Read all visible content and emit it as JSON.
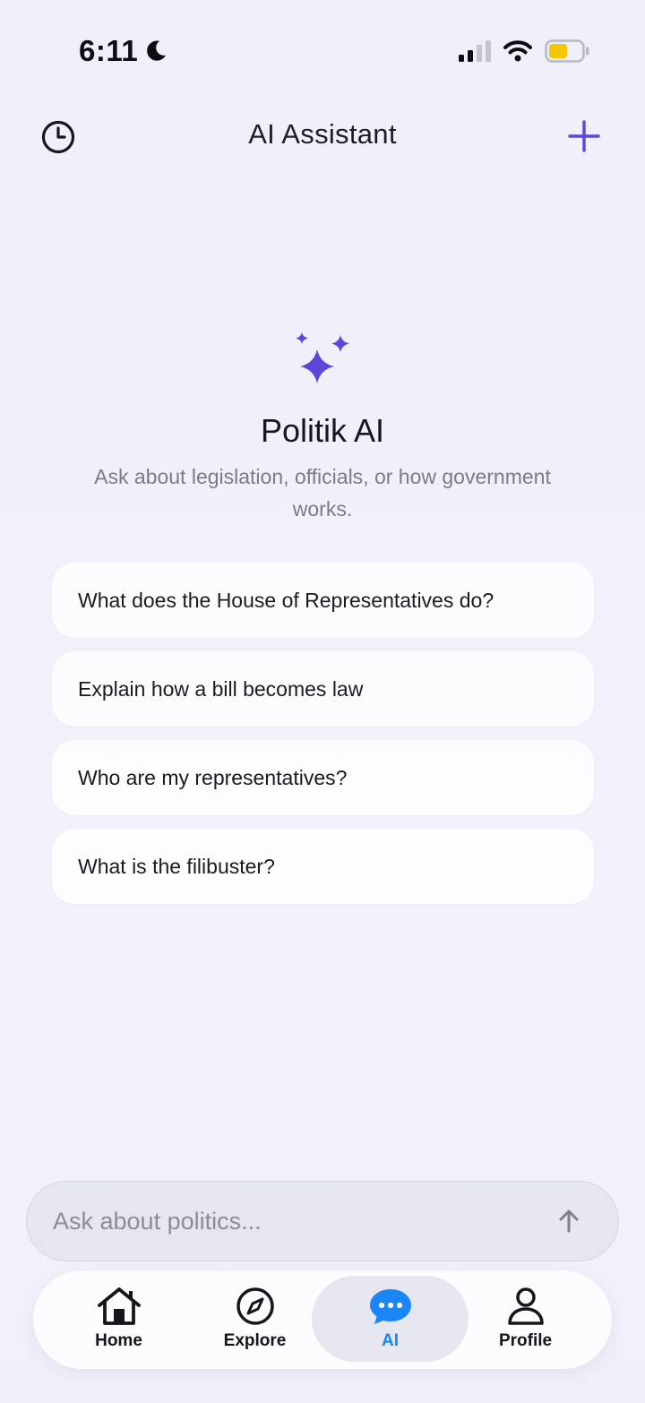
{
  "status": {
    "time": "6:11"
  },
  "header": {
    "title": "AI Assistant"
  },
  "hero": {
    "title": "Politik AI",
    "subtitle": "Ask about legislation, officials, or how government works."
  },
  "suggestions": [
    "What does the House of Representatives do?",
    "Explain how a bill becomes law",
    "Who are my representatives?",
    "What is the filibuster?"
  ],
  "input": {
    "placeholder": "Ask about politics..."
  },
  "tabs": [
    {
      "label": "Home",
      "icon": "house-icon"
    },
    {
      "label": "Explore",
      "icon": "compass-icon"
    },
    {
      "label": "AI",
      "icon": "chat-bubble-icon",
      "active": true
    },
    {
      "label": "Profile",
      "icon": "person-icon"
    }
  ],
  "colors": {
    "accent": "#5b48d9",
    "active_tab": "#1a86f5",
    "battery": "#f5c600"
  }
}
